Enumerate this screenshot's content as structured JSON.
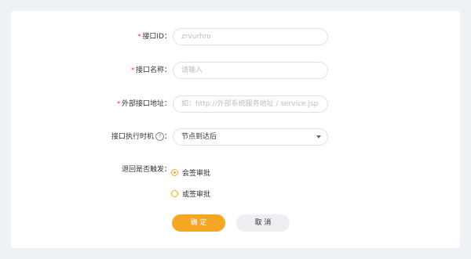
{
  "form": {
    "interface_id": {
      "required_mark": "*",
      "label": "接口ID：",
      "value": "zrvurhro"
    },
    "interface_name": {
      "required_mark": "*",
      "label": "接口名称：",
      "placeholder": "请输入"
    },
    "external_url": {
      "required_mark": "*",
      "label": "外部接口地址：",
      "placeholder": "如：http://外部系统服务地址 / service.jsp"
    },
    "exec_timing": {
      "label": "接口执行时机",
      "help_icon": "?",
      "colon": "：",
      "value": "节点到达后",
      "icon": "chevron-down-icon"
    },
    "return_trigger": {
      "label": "退回是否触发：",
      "options": [
        {
          "label": "会签审批",
          "selected": true
        },
        {
          "label": "或签审批",
          "selected": false
        }
      ]
    }
  },
  "actions": {
    "confirm_label": "确 定",
    "cancel_label": "取 消"
  },
  "colors": {
    "accent": "#f5a623",
    "required": "#f5222d",
    "background": "#eef1f5"
  }
}
